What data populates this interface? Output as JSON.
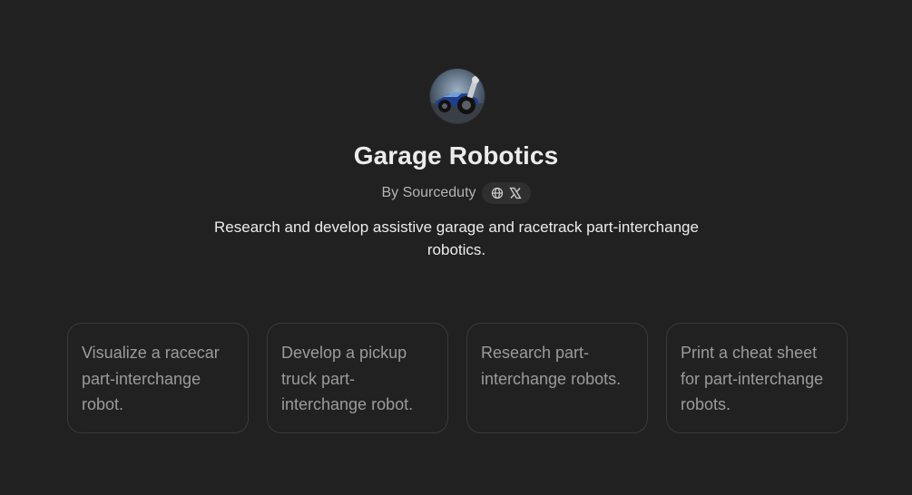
{
  "gpt": {
    "name": "Garage Robotics",
    "author": "By Sourceduty",
    "description": "Research and develop assistive garage and racetrack part-interchange robotics."
  },
  "social": {
    "website_icon": "globe-icon",
    "x_icon": "x-logo-icon"
  },
  "conversation_starters": [
    {
      "label": "Visualize a racecar part-interchange robot."
    },
    {
      "label": "Develop a pickup truck part-interchange robot."
    },
    {
      "label": "Research part-interchange robots."
    },
    {
      "label": "Print a cheat sheet for part-interchange robots."
    }
  ],
  "colors": {
    "background": "#212121",
    "card_border": "#3a3a3a",
    "text_primary": "#ececec",
    "text_muted": "#b4b4b4"
  }
}
